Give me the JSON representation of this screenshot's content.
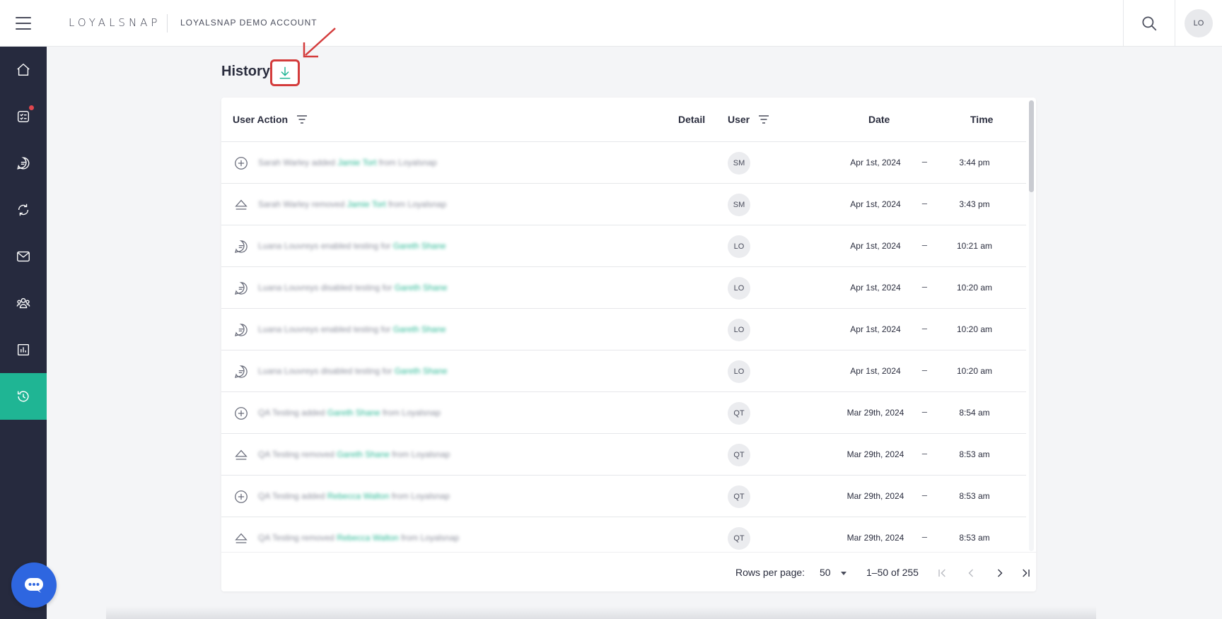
{
  "header": {
    "logo_text": "LOYALSNAP",
    "account_name": "LOYALSNAP DEMO ACCOUNT",
    "avatar_initials": "LO"
  },
  "sidebar": {
    "items": [
      {
        "icon": "home-icon",
        "active": false
      },
      {
        "icon": "checklist-icon",
        "active": false,
        "notification": true
      },
      {
        "icon": "chat-icon",
        "active": false
      },
      {
        "icon": "refresh-icon",
        "active": false
      },
      {
        "icon": "mail-icon",
        "active": false
      },
      {
        "icon": "people-icon",
        "active": false
      },
      {
        "icon": "bar-chart-icon",
        "active": false
      },
      {
        "icon": "history-icon",
        "active": true
      }
    ]
  },
  "page": {
    "title": "History"
  },
  "table": {
    "columns": {
      "user_action": "User Action",
      "detail": "Detail",
      "user": "User",
      "date": "Date",
      "time": "Time"
    },
    "rows": [
      {
        "icon": "plus-circle-icon",
        "actor": "Sarah Warley",
        "verb": "added",
        "target": "Jamie Tort",
        "suffix": "from Loyalsnap",
        "detail": "–",
        "user": "SM",
        "date": "Apr 1st, 2024",
        "time": "3:44 pm"
      },
      {
        "icon": "eject-icon",
        "actor": "Sarah Warley",
        "verb": "removed",
        "target": "Jamie Tort",
        "suffix": "from Loyalsnap",
        "detail": "–",
        "user": "SM",
        "date": "Apr 1st, 2024",
        "time": "3:43 pm"
      },
      {
        "icon": "message-icon",
        "actor": "Luana Louvreys",
        "verb": "enabled testing for",
        "target": "Gareth Shane",
        "suffix": "",
        "detail": "–",
        "user": "LO",
        "date": "Apr 1st, 2024",
        "time": "10:21 am"
      },
      {
        "icon": "message-icon",
        "actor": "Luana Louvreys",
        "verb": "disabled testing for",
        "target": "Gareth Shane",
        "suffix": "",
        "detail": "–",
        "user": "LO",
        "date": "Apr 1st, 2024",
        "time": "10:20 am"
      },
      {
        "icon": "message-icon",
        "actor": "Luana Louvreys",
        "verb": "enabled testing for",
        "target": "Gareth Shane",
        "suffix": "",
        "detail": "–",
        "user": "LO",
        "date": "Apr 1st, 2024",
        "time": "10:20 am"
      },
      {
        "icon": "message-icon",
        "actor": "Luana Louvreys",
        "verb": "disabled testing for",
        "target": "Gareth Shane",
        "suffix": "",
        "detail": "–",
        "user": "LO",
        "date": "Apr 1st, 2024",
        "time": "10:20 am"
      },
      {
        "icon": "plus-circle-icon",
        "actor": "QA Testing",
        "verb": "added",
        "target": "Gareth Shane",
        "suffix": "from Loyalsnap",
        "detail": "–",
        "user": "QT",
        "date": "Mar 29th, 2024",
        "time": "8:54 am"
      },
      {
        "icon": "eject-icon",
        "actor": "QA Testing",
        "verb": "removed",
        "target": "Gareth Shane",
        "suffix": "from Loyalsnap",
        "detail": "–",
        "user": "QT",
        "date": "Mar 29th, 2024",
        "time": "8:53 am"
      },
      {
        "icon": "plus-circle-icon",
        "actor": "QA Testing",
        "verb": "added",
        "target": "Rebecca Walton",
        "suffix": "from Loyalsnap",
        "detail": "–",
        "user": "QT",
        "date": "Mar 29th, 2024",
        "time": "8:53 am"
      },
      {
        "icon": "eject-icon",
        "actor": "QA Testing",
        "verb": "removed",
        "target": "Rebecca Walton",
        "suffix": "from Loyalsnap",
        "detail": "–",
        "user": "QT",
        "date": "Mar 29th, 2024",
        "time": "8:53 am"
      }
    ]
  },
  "pagination": {
    "rows_per_page_label": "Rows per page:",
    "rows_per_page_value": "50",
    "range_text": "1–50 of 255"
  },
  "colors": {
    "accent": "#1fb594",
    "sidebar_bg": "#262a3e",
    "highlight_box": "#d43c3c",
    "chat_button": "#2e66e0"
  }
}
